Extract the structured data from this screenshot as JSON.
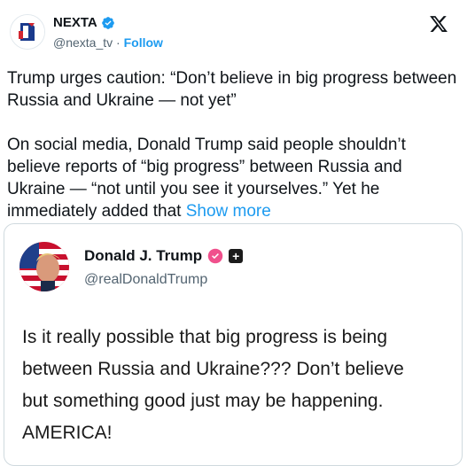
{
  "header": {
    "name": "NEXTA",
    "handle": "@nexta_tv",
    "separator": "·",
    "follow_label": "Follow"
  },
  "tweet": {
    "headline": "Trump urges caution: “Don’t believe in big progress between Russia and Ukraine — not yet”",
    "body": "On social media, Donald Trump said people shouldn’t believe reports of “big progress” between Russia and Ukraine — “not until you see it yourselves.” Yet he immediately added that",
    "show_more": "Show more"
  },
  "quoted": {
    "name": "Donald J. Trump",
    "handle": "@realDonaldTrump",
    "badge_square_glyph": "+",
    "lines": [
      "Is it really possible that big progress is being",
      "between Russia and Ukraine??? Don’t believe",
      "but something good just may be happening.",
      "AMERICA!"
    ]
  },
  "colors": {
    "link": "#1d9bf0",
    "verified": "#1d9bf0",
    "trump_badge": "#f0508c",
    "nexta_red": "#d22630"
  },
  "icons": [
    "nexta-logo-icon",
    "verified-badge-icon",
    "x-logo-icon",
    "trump-avatar-icon",
    "pink-verified-badge-icon",
    "square-plus-badge-icon"
  ]
}
